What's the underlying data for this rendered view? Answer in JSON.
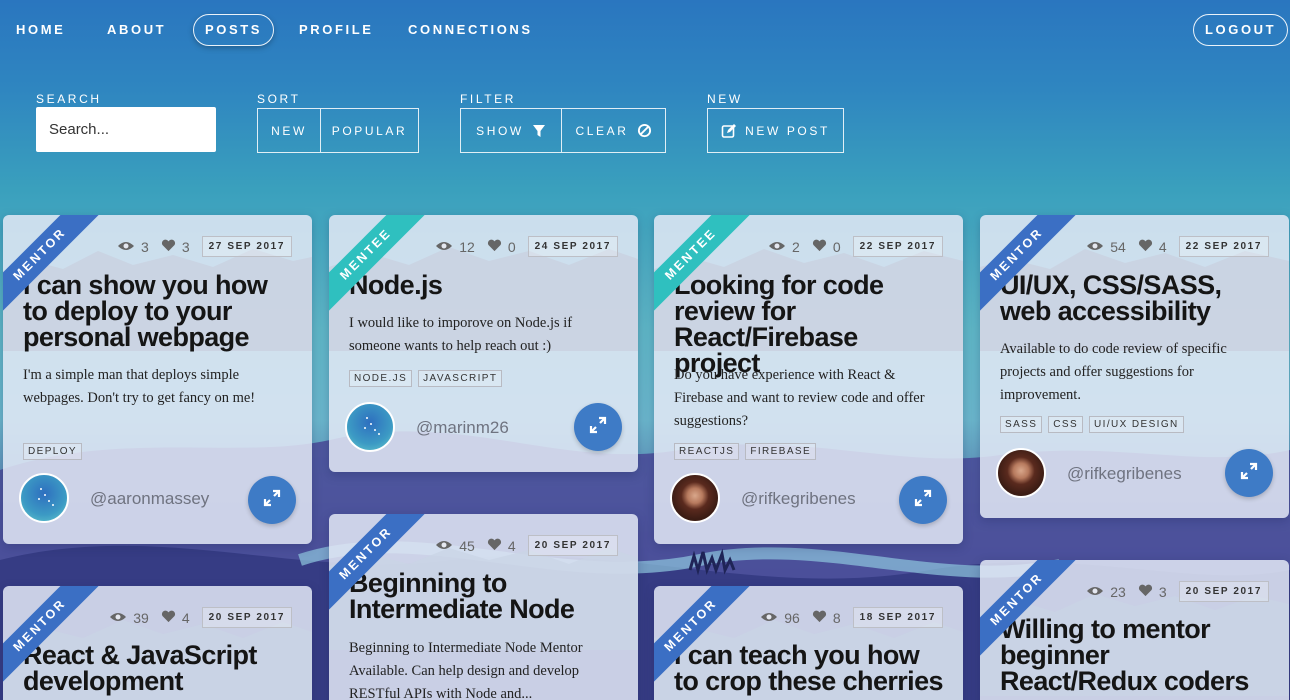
{
  "nav": {
    "items": [
      "HOME",
      "ABOUT",
      "POSTS",
      "PROFILE",
      "CONNECTIONS"
    ],
    "active": "POSTS",
    "logout": "LOGOUT"
  },
  "controls": {
    "search_label": "SEARCH",
    "search_placeholder": "Search...",
    "sort_label": "SORT",
    "sort_new": "NEW",
    "sort_popular": "POPULAR",
    "filter_label": "FILTER",
    "filter_show": "SHOW",
    "filter_clear": "CLEAR",
    "new_label": "NEW",
    "new_post": "NEW POST"
  },
  "colors": {
    "mentor": "#3b6fc4",
    "mentee": "#2fc0bf",
    "expand": "#3e7bc6"
  },
  "cards": [
    {
      "ribbon": "MENTOR",
      "views": "3",
      "likes": "3",
      "date": "27 SEP 2017",
      "title": "I can show you how to deploy to your personal webpage",
      "desc": "I'm a simple man that deploys simple webpages. Don't try to get fancy on me!",
      "tags": [
        "DEPLOY"
      ],
      "user": "@aaronmassey",
      "avatar": "blue-stars"
    },
    {
      "ribbon": "MENTEE",
      "views": "12",
      "likes": "0",
      "date": "24 SEP 2017",
      "title": "Node.js",
      "desc": "I would like to imporove on Node.js if someone wants to help reach out :)",
      "tags": [
        "NODE.JS",
        "JAVASCRIPT"
      ],
      "user": "@marinm26",
      "avatar": "blue-stars"
    },
    {
      "ribbon": "MENTEE",
      "views": "2",
      "likes": "0",
      "date": "22 SEP 2017",
      "title": "Looking for code review for React/Firebase project",
      "desc": "Do you have experience with React & Firebase and want to review code and offer suggestions?",
      "tags": [
        "REACTJS",
        "FIREBASE"
      ],
      "user": "@rifkegribenes",
      "avatar": "photo"
    },
    {
      "ribbon": "MENTOR",
      "views": "54",
      "likes": "4",
      "date": "22 SEP 2017",
      "title": "UI/UX, CSS/SASS, web accessibility",
      "desc": "Available to do code review of specific projects and offer suggestions for improvement.",
      "tags": [
        "SASS",
        "CSS",
        "UI/UX DESIGN"
      ],
      "user": "@rifkegribenes",
      "avatar": "photo"
    },
    {
      "ribbon": "MENTOR",
      "views": "39",
      "likes": "4",
      "date": "20 SEP 2017",
      "title": "React & JavaScript development"
    },
    {
      "ribbon": "MENTOR",
      "views": "45",
      "likes": "4",
      "date": "20 SEP 2017",
      "title": "Beginning to Intermediate Node",
      "desc": "Beginning to Intermediate Node Mentor Available. Can help design and develop RESTful APIs with Node and..."
    },
    {
      "ribbon": "MENTOR",
      "views": "96",
      "likes": "8",
      "date": "18 SEP 2017",
      "title": "I can teach you how to crop these cherries"
    },
    {
      "ribbon": "MENTOR",
      "views": "23",
      "likes": "3",
      "date": "20 SEP 2017",
      "title": "Willing to mentor beginner React/Redux coders"
    }
  ]
}
